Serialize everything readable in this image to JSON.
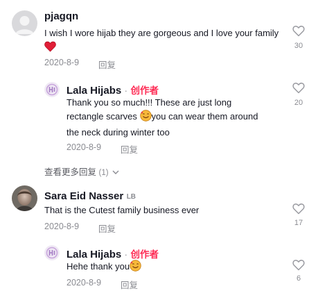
{
  "comments": [
    {
      "username": "pjagqn",
      "text": "I wish I wore hijab they are gorgeous and I love your family",
      "date": "2020-8-9",
      "reply_label": "回复",
      "likes": "30"
    },
    {
      "username": "Lala Hijabs",
      "separator": "·",
      "role": "创作者",
      "text_line1": "Thank you so much!!! These are just long",
      "text_line2_a": "rectangle scarves",
      "text_line2_b": "you can wear them around",
      "text_line3": "the neck during winter too",
      "date": "2020-8-9",
      "reply_label": "回复",
      "likes": "20"
    },
    {
      "view_more": "查看更多回复",
      "view_more_count": "(1)"
    },
    {
      "username": "Sara Eid Nasser",
      "badge": "LB",
      "text": "That is the Cutest family business ever",
      "date": "2020-8-9",
      "reply_label": "回复",
      "likes": "17"
    },
    {
      "username": "Lala Hijabs",
      "separator": "·",
      "role": "创作者",
      "text": "Hehe thank you",
      "date": "2020-8-9",
      "reply_label": "回复",
      "likes": "6"
    }
  ],
  "icons": {
    "like": "heart-outline-icon",
    "red_heart": "red-heart-emoji",
    "smile": "smiling-face-hearts-emoji",
    "expand": "chevron-down-icon"
  },
  "colors": {
    "creator_accent": "#fe2c55",
    "secondary_text": "#8a8b91"
  }
}
